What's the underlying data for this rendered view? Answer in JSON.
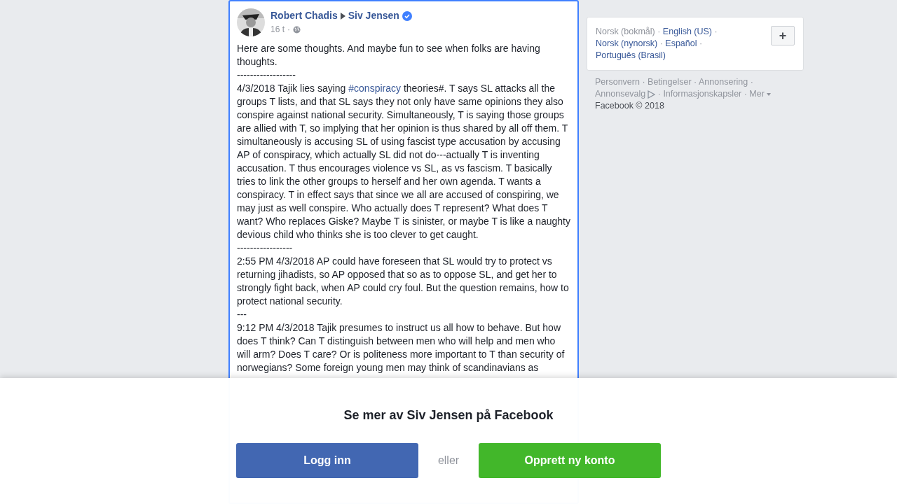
{
  "post": {
    "author": "Robert Chadis",
    "target": "Siv Jensen",
    "verified": true,
    "time": "16 t",
    "time_separator": "·",
    "audience_icon": true,
    "paragraphs": [
      [
        {
          "kind": "text",
          "text": "Here are some thoughts. And maybe fun to see when folks are having thoughts."
        }
      ],
      [
        {
          "kind": "text",
          "text": "------------------"
        }
      ],
      [
        {
          "kind": "text",
          "text": "4/3/2018 Tajik lies saying "
        },
        {
          "kind": "link",
          "text": "#conspiracy"
        },
        {
          "kind": "text",
          "text": " theories#. T says SL attacks all the groups T lists, and that SL says they not only have same opinions they also conspire against national security. Simultaneously, T is saying those groups are allied with T, so implying that her opinion is thus shared by all off them. T simultaneously is accusing SL of using fascist type accusation by accusing AP of conspiracy, which actually SL did not do---actually T is inventing accusation. T thus encourages violence vs SL, as vs fascism. T basically tries to link the other groups to herself and her own agenda. T wants a conspiracy. T in effect says that since we all are accused of conspiring, we may just as well conspire. Who actually does T represent? What does T want? Who replaces Giske? Maybe T is sinister, or maybe T is like a naughty devious child who thinks she is too clever to get caught."
        }
      ],
      [
        {
          "kind": "text",
          "text": "-----------------"
        }
      ],
      [
        {
          "kind": "text",
          "text": "2:55 PM 4/3/2018 AP could have foreseen that SL would try to protect vs returning jihadists, so AP opposed that so as to oppose SL, and get her to strongly fight back, when AP could cry foul. But the question remains, how to protect national security."
        }
      ],
      [
        {
          "kind": "text",
          "text": "---"
        }
      ],
      [
        {
          "kind": "text",
          "text": "9:12 PM 4/3/2018 Tajik presumes to instruct us all how to behave. But how does T think? Can T distinguish between men who will help and men who will arm? Does T care? Or is politeness more important to T than security of norwegians? Some foreign young men may think of scandinavians as"
        }
      ]
    ]
  },
  "languages": [
    {
      "label": "Norsk (bokmål)",
      "selected": true,
      "separator": "·"
    },
    {
      "label": "English (US)",
      "selected": false,
      "separator": "·"
    },
    {
      "label": "Norsk (nynorsk)",
      "selected": false,
      "separator": "·"
    },
    {
      "label": "Español",
      "selected": false,
      "separator": "·"
    },
    {
      "label": "Português (Brasil)",
      "selected": false
    }
  ],
  "add_language": "+",
  "footer_links": [
    {
      "label": "Personvern",
      "kind": "link",
      "separator": "·"
    },
    {
      "label": "Betingelser",
      "kind": "link",
      "separator": "·"
    },
    {
      "label": "Annonsering",
      "kind": "link",
      "separator": "·"
    },
    {
      "label": "Annonsevalg",
      "kind": "adchoices",
      "separator": "·"
    },
    {
      "label": "Informasjonskapsler",
      "kind": "link",
      "separator": "·"
    },
    {
      "label": "Mer",
      "kind": "menu"
    }
  ],
  "copyright": "Facebook © 2018",
  "overlay": {
    "title": "Se mer av Siv Jensen på Facebook",
    "login": "Logg inn",
    "or": "eller",
    "signup": "Opprett ny konto"
  }
}
